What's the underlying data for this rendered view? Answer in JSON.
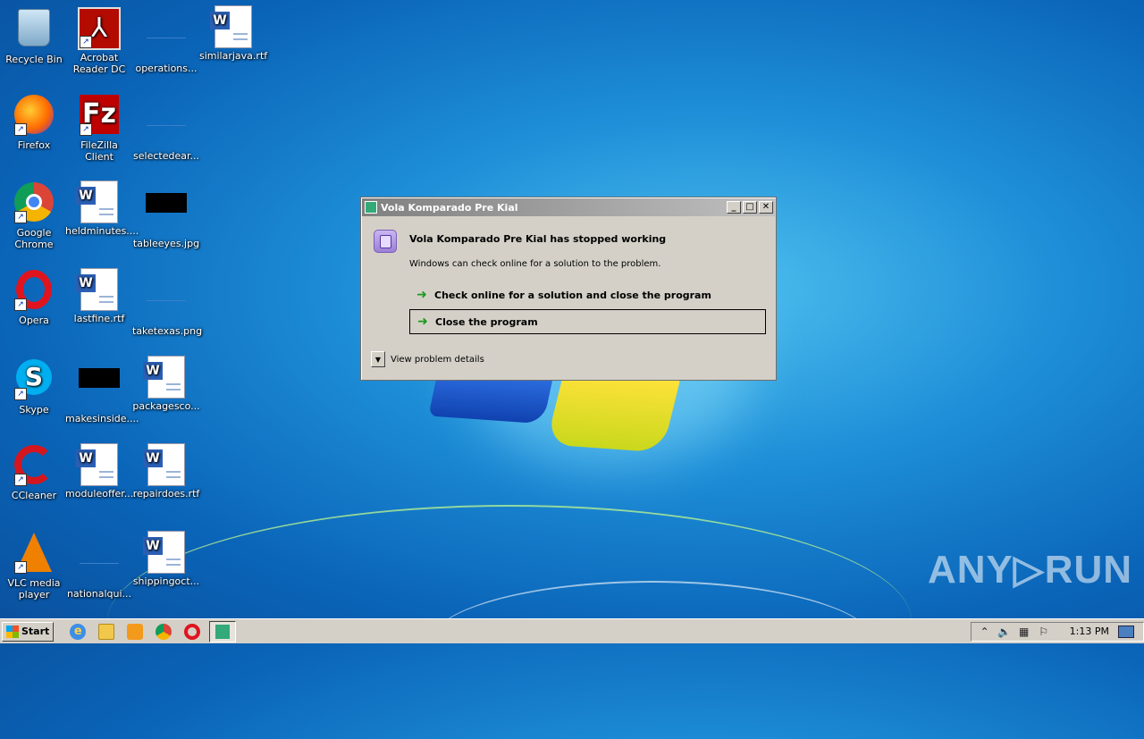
{
  "desktop": {
    "icons": [
      {
        "label": "Recycle Bin",
        "icon": "recycle-bin-icon"
      },
      {
        "label": "Acrobat Reader DC",
        "icon": "acrobat-icon"
      },
      {
        "label": "operations...",
        "icon": "blank-file-icon"
      },
      {
        "label": "similarjava.rtf",
        "icon": "word-doc-icon"
      },
      {
        "label": "Firefox",
        "icon": "firefox-icon"
      },
      {
        "label": "FileZilla Client",
        "icon": "filezilla-icon"
      },
      {
        "label": "selectedear...",
        "icon": "blank-file-icon"
      },
      {
        "label": "Google Chrome",
        "icon": "chrome-icon"
      },
      {
        "label": "heldminutes....",
        "icon": "word-doc-icon"
      },
      {
        "label": "tableeyes.jpg",
        "icon": "image-thumbnail-icon"
      },
      {
        "label": "Opera",
        "icon": "opera-icon"
      },
      {
        "label": "lastfine.rtf",
        "icon": "word-doc-icon"
      },
      {
        "label": "taketexas.png",
        "icon": "blank-file-icon"
      },
      {
        "label": "Skype",
        "icon": "skype-icon"
      },
      {
        "label": "makesinside....",
        "icon": "image-thumbnail-icon"
      },
      {
        "label": "packagesco...",
        "icon": "word-doc-icon"
      },
      {
        "label": "CCleaner",
        "icon": "ccleaner-icon"
      },
      {
        "label": "moduleoffer....",
        "icon": "word-doc-icon"
      },
      {
        "label": "repairdoes.rtf",
        "icon": "word-doc-icon"
      },
      {
        "label": "VLC media player",
        "icon": "vlc-icon"
      },
      {
        "label": "nationalqui...",
        "icon": "blank-file-icon"
      },
      {
        "label": "shippingoct...",
        "icon": "word-doc-icon"
      }
    ]
  },
  "dialog": {
    "title": "Vola Komparado Pre Kial",
    "heading": "Vola Komparado Pre Kial has stopped working",
    "message": "Windows can check online for a solution to the problem.",
    "option_check": "Check online for a solution and close the program",
    "option_close": "Close the program",
    "details": "View problem details",
    "btn_min": "_",
    "btn_max": "□",
    "btn_close": "✕"
  },
  "watermark": "ANY▷RUN",
  "taskbar": {
    "start_label": "Start",
    "clock": "1:13 PM"
  },
  "colors": {
    "accent_green": "#1a9a1a",
    "desktop_blue": "#1e8fd8"
  }
}
